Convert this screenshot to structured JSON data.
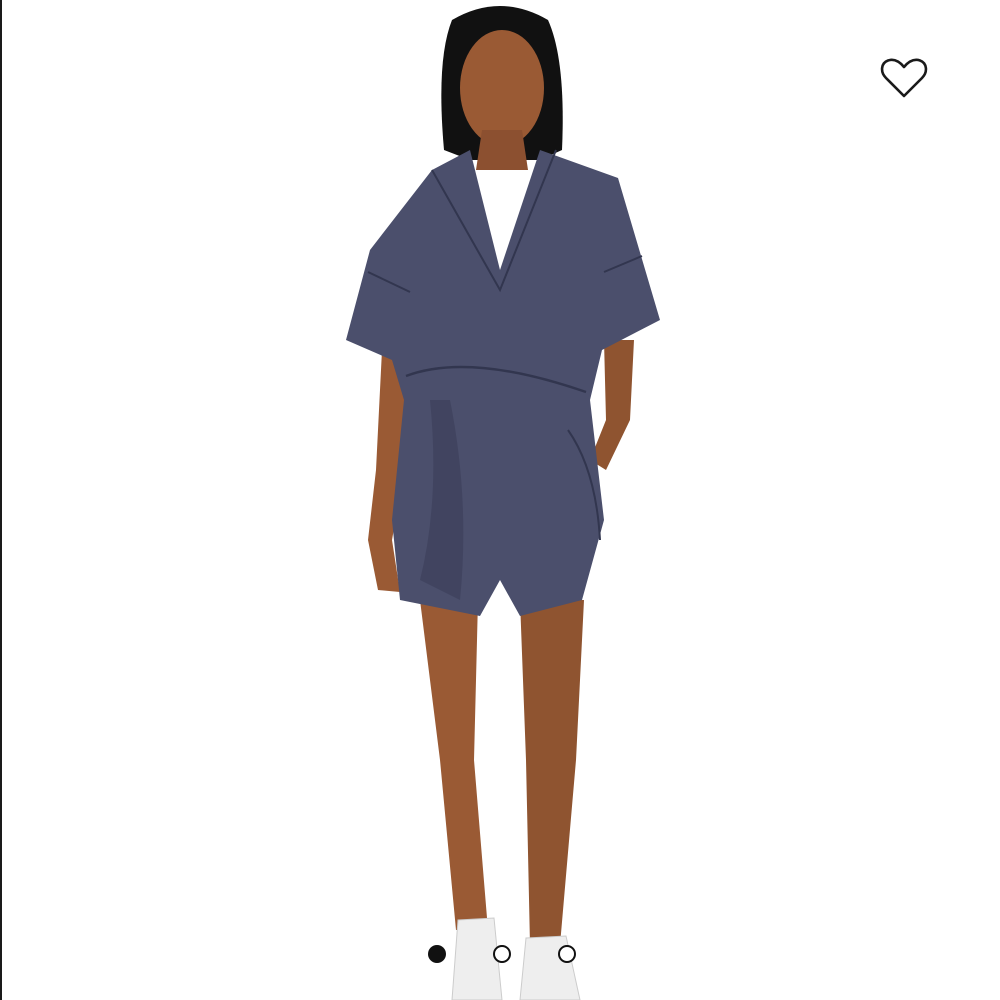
{
  "listing": {
    "image": {
      "subject": "product-photo",
      "colors": {
        "background": "#ffffff",
        "garment": "#4b4f6c",
        "garment_shadow": "#3a3e58",
        "skin": "#9a5a34",
        "hair": "#111111",
        "shoes": "#eeeeee"
      }
    },
    "favorite": {
      "icon": "heart-outline-icon",
      "active": false
    },
    "carousel": {
      "count": 3,
      "active_index": 0,
      "dots": [
        {
          "state": "active"
        },
        {
          "state": "inactive"
        },
        {
          "state": "inactive"
        }
      ]
    }
  }
}
